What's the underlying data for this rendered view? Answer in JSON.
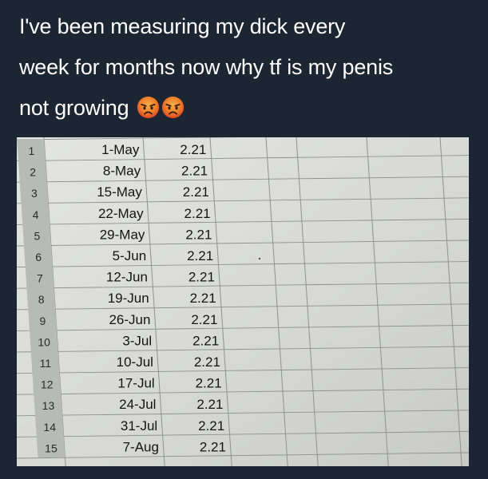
{
  "tweet": {
    "lines": [
      "I've been measuring my dick every",
      "week for months now why tf is my penis",
      "not growing"
    ],
    "emojis": [
      "angry-face-emoji",
      "angry-face-emoji"
    ]
  },
  "spreadsheet": {
    "rows": [
      {
        "num": "1",
        "date": "1-May",
        "value": "2.21"
      },
      {
        "num": "2",
        "date": "8-May",
        "value": "2.21"
      },
      {
        "num": "3",
        "date": "15-May",
        "value": "2.21"
      },
      {
        "num": "4",
        "date": "22-May",
        "value": "2.21"
      },
      {
        "num": "5",
        "date": "29-May",
        "value": "2.21"
      },
      {
        "num": "6",
        "date": "5-Jun",
        "value": "2.21"
      },
      {
        "num": "7",
        "date": "12-Jun",
        "value": "2.21"
      },
      {
        "num": "8",
        "date": "19-Jun",
        "value": "2.21"
      },
      {
        "num": "9",
        "date": "26-Jun",
        "value": "2.21"
      },
      {
        "num": "10",
        "date": "3-Jul",
        "value": "2.21"
      },
      {
        "num": "11",
        "date": "10-Jul",
        "value": "2.21"
      },
      {
        "num": "12",
        "date": "17-Jul",
        "value": "2.21"
      },
      {
        "num": "13",
        "date": "24-Jul",
        "value": "2.21"
      },
      {
        "num": "14",
        "date": "31-Jul",
        "value": "2.21"
      },
      {
        "num": "15",
        "date": "7-Aug",
        "value": "2.21"
      }
    ]
  },
  "colors": {
    "background": "#1c2532",
    "text": "#ffffff",
    "sheet": "#d9dad6",
    "rowheader": "#b8bab6",
    "gridline": "#8f918c",
    "emoji_face": "#f08a2c",
    "emoji_face_top": "#e2452b"
  }
}
